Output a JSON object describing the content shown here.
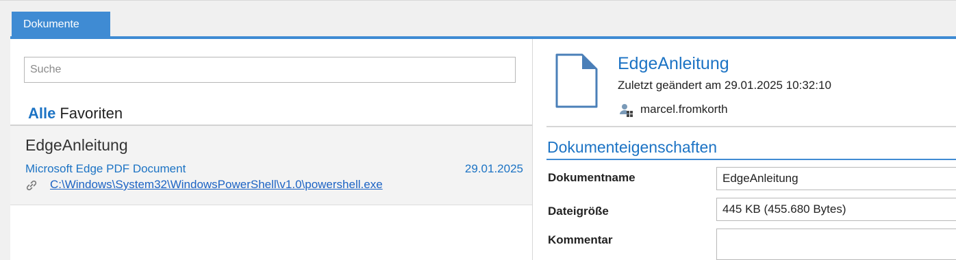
{
  "tabs": [
    {
      "label": "Dokumente",
      "active": true
    }
  ],
  "accent_color": "#3f8bd3",
  "search": {
    "placeholder": "Suche",
    "value": ""
  },
  "filters": {
    "all_label": "Alle",
    "favorites_label": "Favoriten",
    "active": "Alle"
  },
  "list": {
    "items": [
      {
        "title": "EdgeAnleitung",
        "type": "Microsoft Edge PDF Document",
        "date": "29.01.2025",
        "link_icon": "link-icon",
        "path": "C:\\Windows\\System32\\WindowsPowerShell\\v1.0\\powershell.exe"
      }
    ]
  },
  "detail": {
    "icon": "document-icon",
    "title": "EdgeAnleitung",
    "changed": "Zuletzt geändert am 29.01.2025 10:32:10",
    "user_icon": "user-icon",
    "user": "marcel.fromkorth"
  },
  "properties": {
    "title": "Dokumenteigenschaften",
    "rows": [
      {
        "label": "Dokumentname",
        "value": "EdgeAnleitung"
      },
      {
        "label": "Dateigröße",
        "value": "445 KB (455.680 Bytes)"
      },
      {
        "label": "Kommentar",
        "value": ""
      }
    ]
  }
}
